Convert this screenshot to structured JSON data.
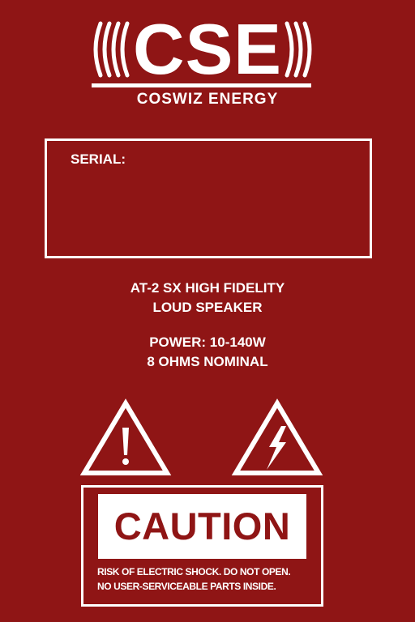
{
  "logo": {
    "mark": "CSE",
    "company": "COSWIZ ENERGY"
  },
  "serial": {
    "label": "SERIAL:"
  },
  "product": {
    "line1": "AT-2 SX HIGH FIDELITY",
    "line2": "LOUD SPEAKER"
  },
  "power": {
    "line1": "POWER: 10-140W",
    "line2": "8 OHMS NOMINAL"
  },
  "caution": {
    "title": "CAUTION",
    "line1": "RISK OF ELECTRIC SHOCK. DO NOT OPEN.",
    "line2": "NO USER-SERVICEABLE PARTS INSIDE."
  },
  "colors": {
    "background": "#8f1515",
    "foreground": "#ffffff"
  },
  "icons": [
    "sound-waves-icon",
    "exclamation-warning-icon",
    "lightning-warning-icon"
  ]
}
